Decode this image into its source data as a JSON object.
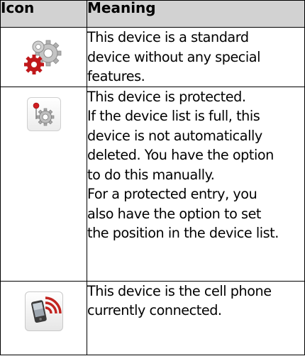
{
  "table": {
    "headers": {
      "icon": "Icon",
      "meaning": "Meaning"
    },
    "rows": [
      {
        "icon": "standard-device-gears-icon",
        "lines": [
          "This device is a standard",
          "device without any special",
          "features."
        ]
      },
      {
        "icon": "protected-device-icon",
        "lines": [
          "This device is protected.",
          "If the device list is full, this",
          "device is not automatically",
          "deleted. You have the option",
          "to do this manually.",
          "For a protected entry, you",
          "also have the option to set",
          "the position in the device list."
        ]
      },
      {
        "icon": "connected-phone-icon",
        "lines": [
          "This device  is the cell phone",
          "currently connected."
        ]
      }
    ]
  },
  "colors": {
    "header_bg": "#d2d2d2",
    "gear_red": "#c0181b",
    "signal_red": "#c22420",
    "gear_grey": "#a8a8a8"
  }
}
